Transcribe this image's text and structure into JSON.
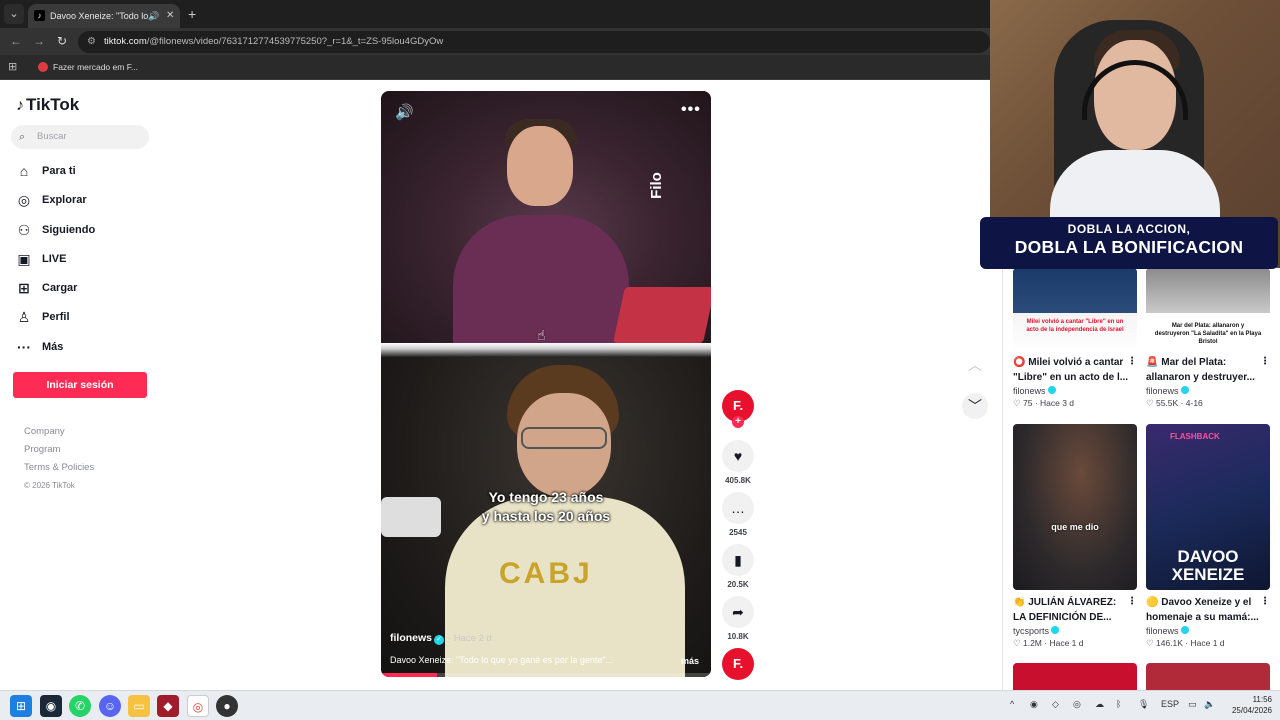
{
  "browser": {
    "tab_title": "Davoo Xeneize: \"Todo lo",
    "new_tab_symbol": "+",
    "url_host": "tiktok.com",
    "url_path": "/@filonews/video/7631712774539775250?_r=1&_t=ZS-95lou4GDyOw",
    "bookmark_label": "Fazer mercado em F..."
  },
  "sidebar": {
    "logo": "TikTok",
    "search_placeholder": "Buscar",
    "nav": [
      {
        "label": "Para ti",
        "icon": "home-icon"
      },
      {
        "label": "Explorar",
        "icon": "compass-icon"
      },
      {
        "label": "Siguiendo",
        "icon": "following-icon"
      },
      {
        "label": "LIVE",
        "icon": "live-icon"
      },
      {
        "label": "Cargar",
        "icon": "upload-icon"
      },
      {
        "label": "Perfil",
        "icon": "profile-icon"
      },
      {
        "label": "Más",
        "icon": "more-icon"
      }
    ],
    "login_button": "Iniciar sesión",
    "footer": [
      "Company",
      "Program",
      "Terms & Policies"
    ],
    "copyright": "© 2026 TikTok"
  },
  "video": {
    "overlay_brand": "Filo",
    "subtitle_line1": "Yo tengo 23 años",
    "subtitle_line2": "y hasta los 20 años",
    "shirt_text": "CABJ",
    "author": "filonews",
    "posted": "· Hace 2 d",
    "description": "Davoo Xeneize: \"Todo lo que yo gané es por la gente\"...",
    "more_label": "más",
    "progress": 0.17
  },
  "actions": {
    "avatar_letter": "F.",
    "likes": "405.8K",
    "comments": "2545",
    "saves": "20.5K",
    "shares": "10.8K"
  },
  "related": [
    {
      "thumb_text": "Milei volvió a cantar \"Libre\" en un acto de la independencia de Israel",
      "title": "Milei volvió a cantar \"Libre\" en un acto de l...",
      "title_icon": "⭕",
      "author": "filonews",
      "likes": "75",
      "age": "Hace 3 d"
    },
    {
      "thumb_text": "Mar del Plata: allanaron y destruyeron \"La Saladita\" en la Playa Bristol",
      "title": "Mar del Plata: allanaron y destruyer...",
      "title_icon": "🚨",
      "author": "filonews",
      "likes": "55.5K",
      "age": "4-16"
    },
    {
      "thumb_text": "que me dio",
      "title": "JULIÁN ÁLVAREZ: LA DEFINICIÓN DE...",
      "title_icon": "👏",
      "author": "tycsports",
      "likes": "1.2M",
      "age": "Hace 1 d"
    },
    {
      "thumb_text": "DAVOO XENEIZE",
      "thumb_badge": "FLASHBACK",
      "title": "Davoo Xeneize y el homenaje a su mamá:...",
      "title_icon": "🟡",
      "author": "filonews",
      "likes": "146.1K",
      "age": "Hace 1 d"
    }
  ],
  "webcam_promo": {
    "line1": "DOBLA LA ACCION,",
    "line2": "DOBLA LA BONIFICACION"
  },
  "taskbar": {
    "language": "ESP",
    "time": "11:56",
    "date": "25/04/2026"
  }
}
